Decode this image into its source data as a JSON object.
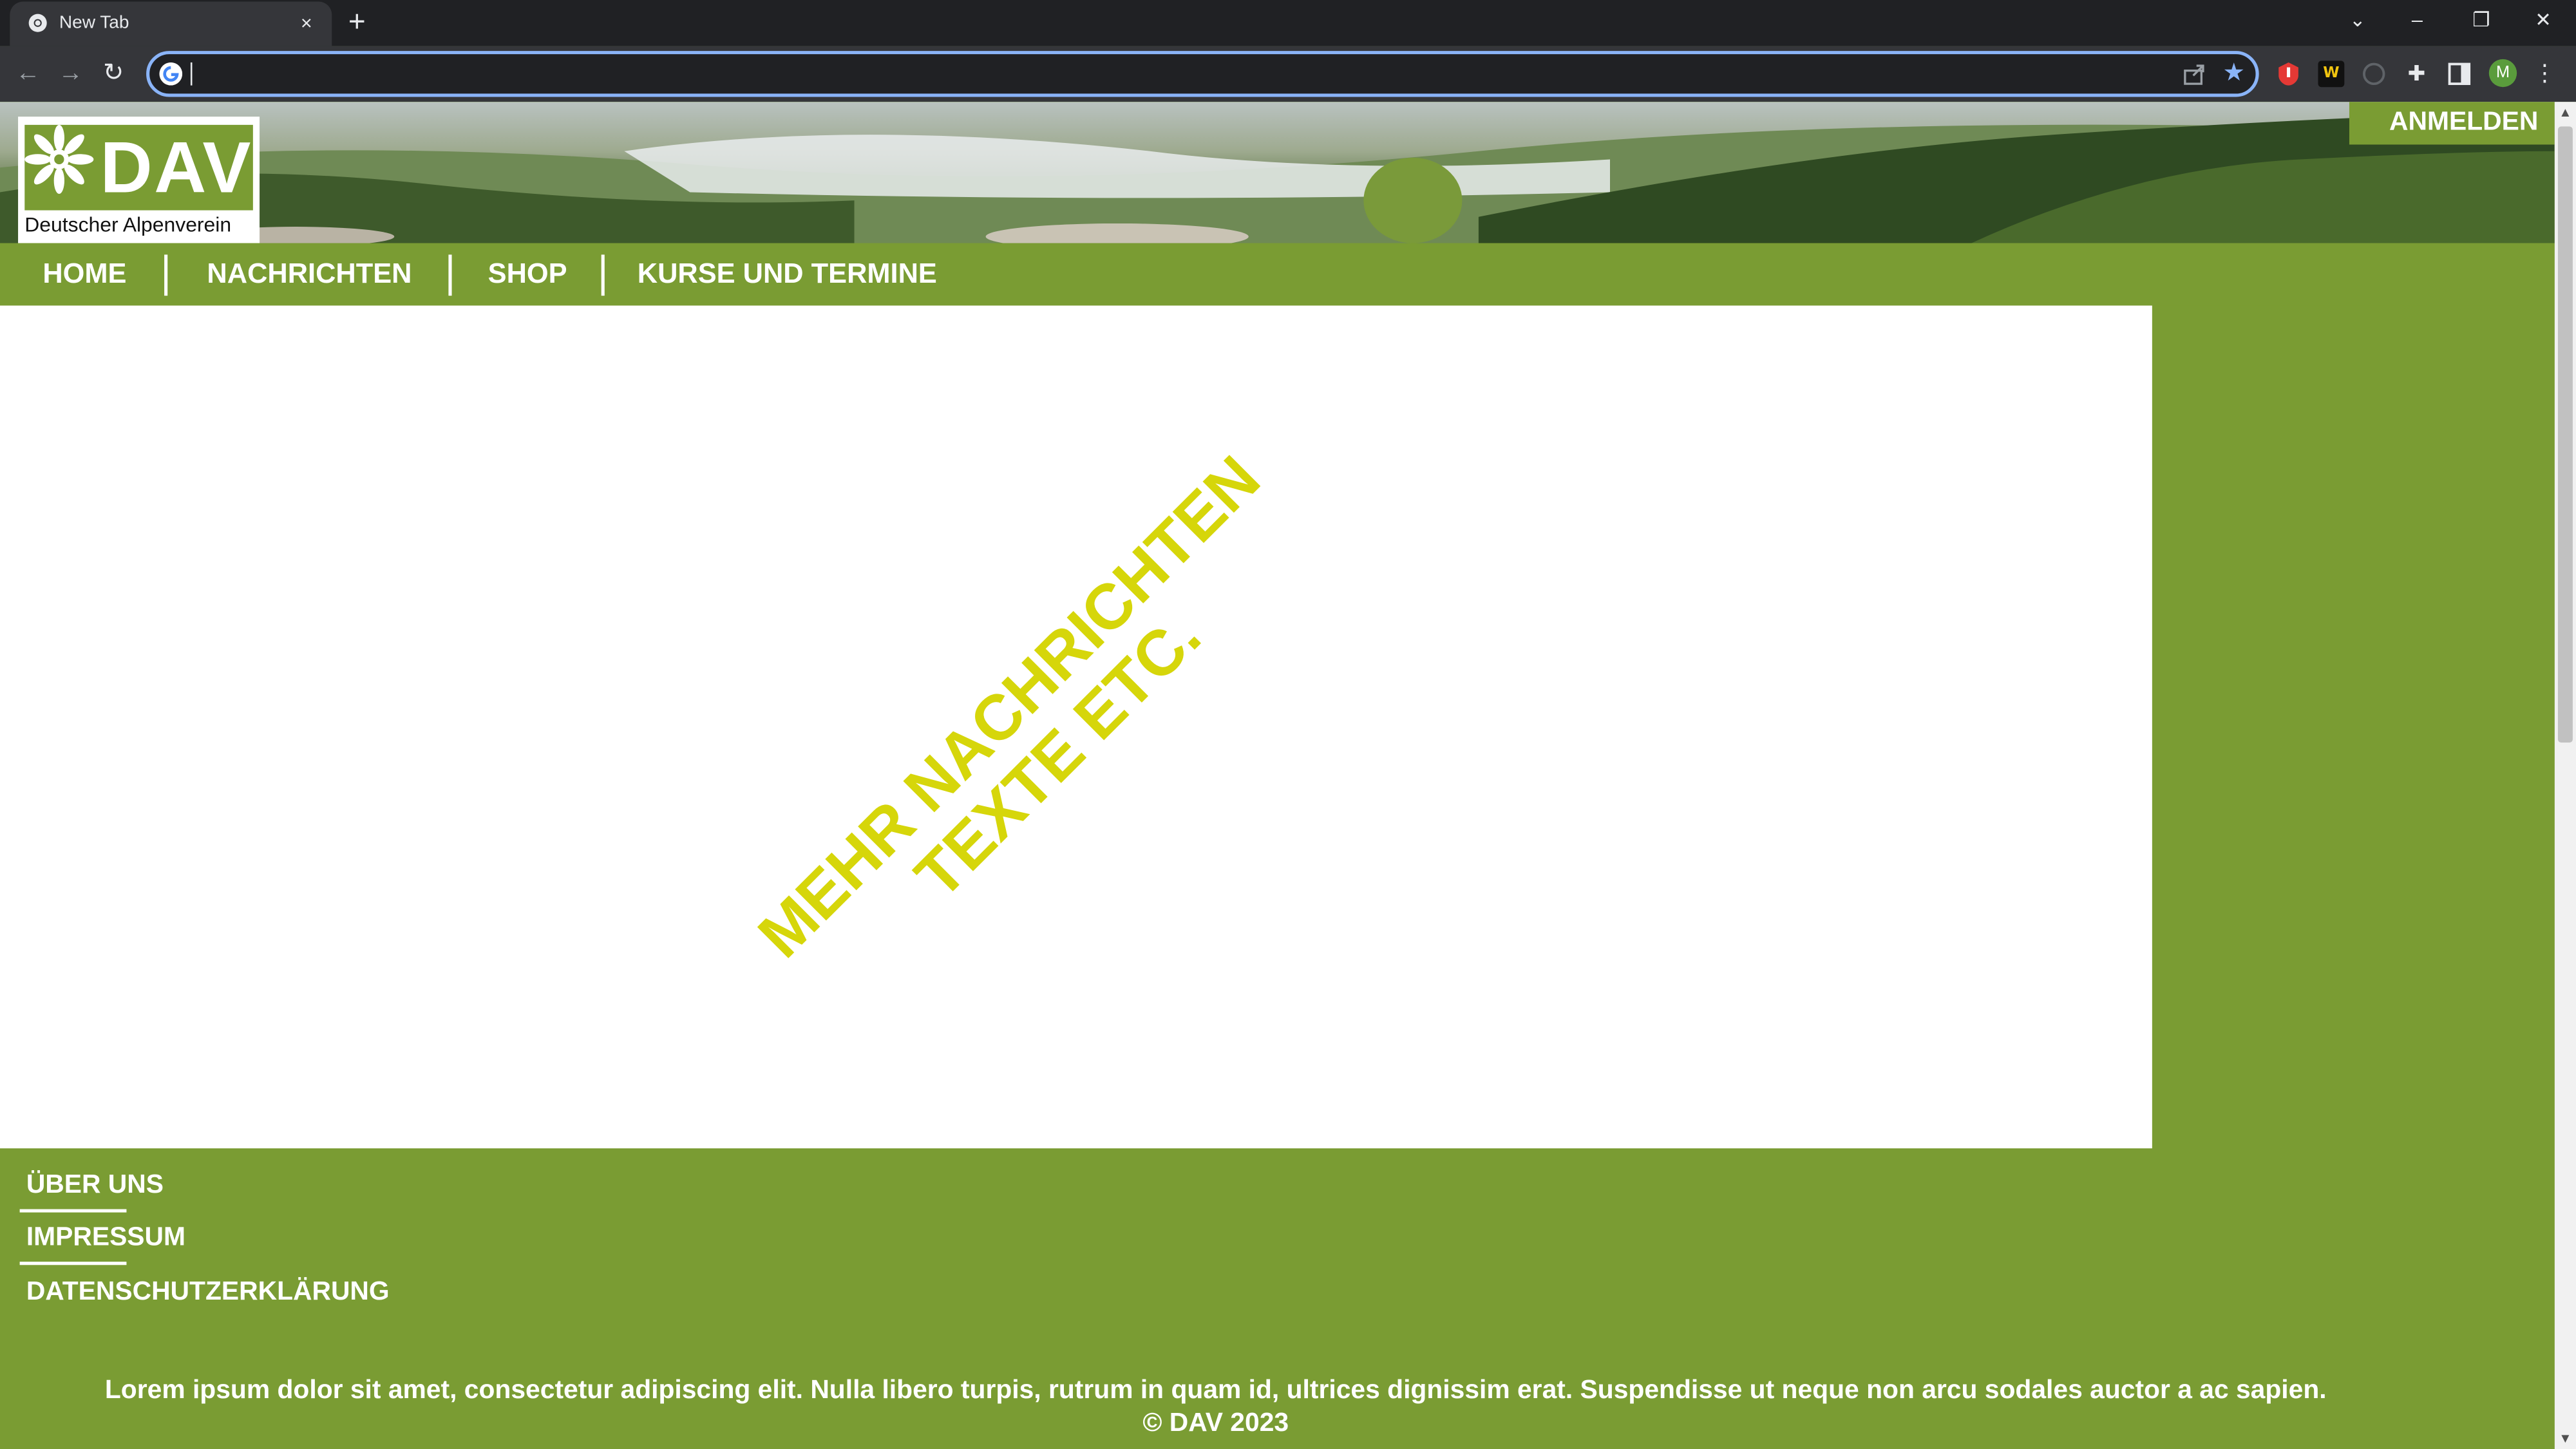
{
  "browser": {
    "tab_title": "New Tab",
    "tab_close": "×",
    "new_tab": "+",
    "address_value": "",
    "avatar_letter": "M",
    "ext_w_label": "W",
    "window_controls": {
      "tabsearch": "⌄",
      "minimize": "–",
      "restore": "❐",
      "close": "✕"
    },
    "nav": {
      "back": "←",
      "forward": "→",
      "reload": "↻"
    }
  },
  "site": {
    "logo_text": "DAV",
    "logo_subtitle": "Deutscher Alpenverein",
    "login_label": "ANMELDEN",
    "nav": [
      {
        "label": "HOME"
      },
      {
        "label": "NACHRICHTEN"
      },
      {
        "label": "SHOP"
      },
      {
        "label": "KURSE UND TERMINE"
      }
    ],
    "content": {
      "line1": "MEHR NACHRICHTEN",
      "line2": "TEXTE ETC."
    },
    "footer": {
      "links": [
        {
          "label": "ÜBER UNS"
        },
        {
          "label": "IMPRESSUM"
        },
        {
          "label": "DATENSCHUTZERKLÄRUNG"
        }
      ],
      "lorem": "Lorem ipsum dolor sit amet, consectetur adipiscing elit. Nulla libero turpis, rutrum in quam id, ultrices dignissim erat. Suspendisse ut neque non arcu sodales auctor a ac sapien.",
      "copyright": "© DAV 2023"
    }
  },
  "colors": {
    "brand_green": "#7a9c33",
    "accent_yellow": "#d6d60a",
    "chrome_dark": "#202124",
    "chrome_toolbar": "#35363a",
    "focus_blue": "#8ab4f8"
  },
  "icons": [
    "chrome-icon",
    "google-g-icon",
    "share-icon",
    "star-icon",
    "extension-red-icon",
    "extension-w-icon",
    "extension-circle-icon",
    "puzzle-icon",
    "side-panel-icon",
    "kebab-menu-icon",
    "edelweiss-icon"
  ]
}
